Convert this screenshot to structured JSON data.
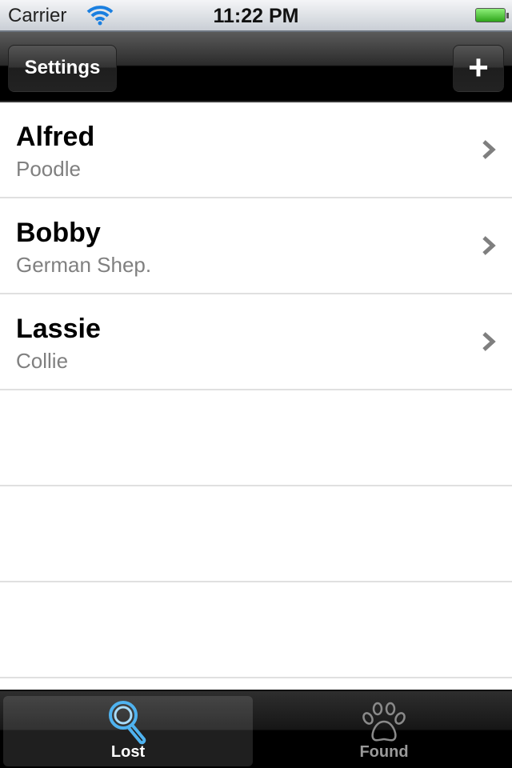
{
  "status_bar": {
    "carrier": "Carrier",
    "time": "11:22 PM",
    "wifi_icon": "wifi-icon",
    "battery_icon": "battery-full-icon"
  },
  "nav_bar": {
    "left_button": "Settings",
    "right_button": "+",
    "right_icon": "plus-icon"
  },
  "list": {
    "items": [
      {
        "name": "Alfred",
        "breed": "Poodle"
      },
      {
        "name": "Bobby",
        "breed": "German Shep."
      },
      {
        "name": "Lassie",
        "breed": "Collie"
      }
    ]
  },
  "tab_bar": {
    "tabs": [
      {
        "label": "Lost",
        "icon": "magnifier-icon",
        "selected": true
      },
      {
        "label": "Found",
        "icon": "paw-icon",
        "selected": false
      }
    ]
  },
  "colors": {
    "accent": "#4fb3f0",
    "subtitle": "#808080"
  }
}
